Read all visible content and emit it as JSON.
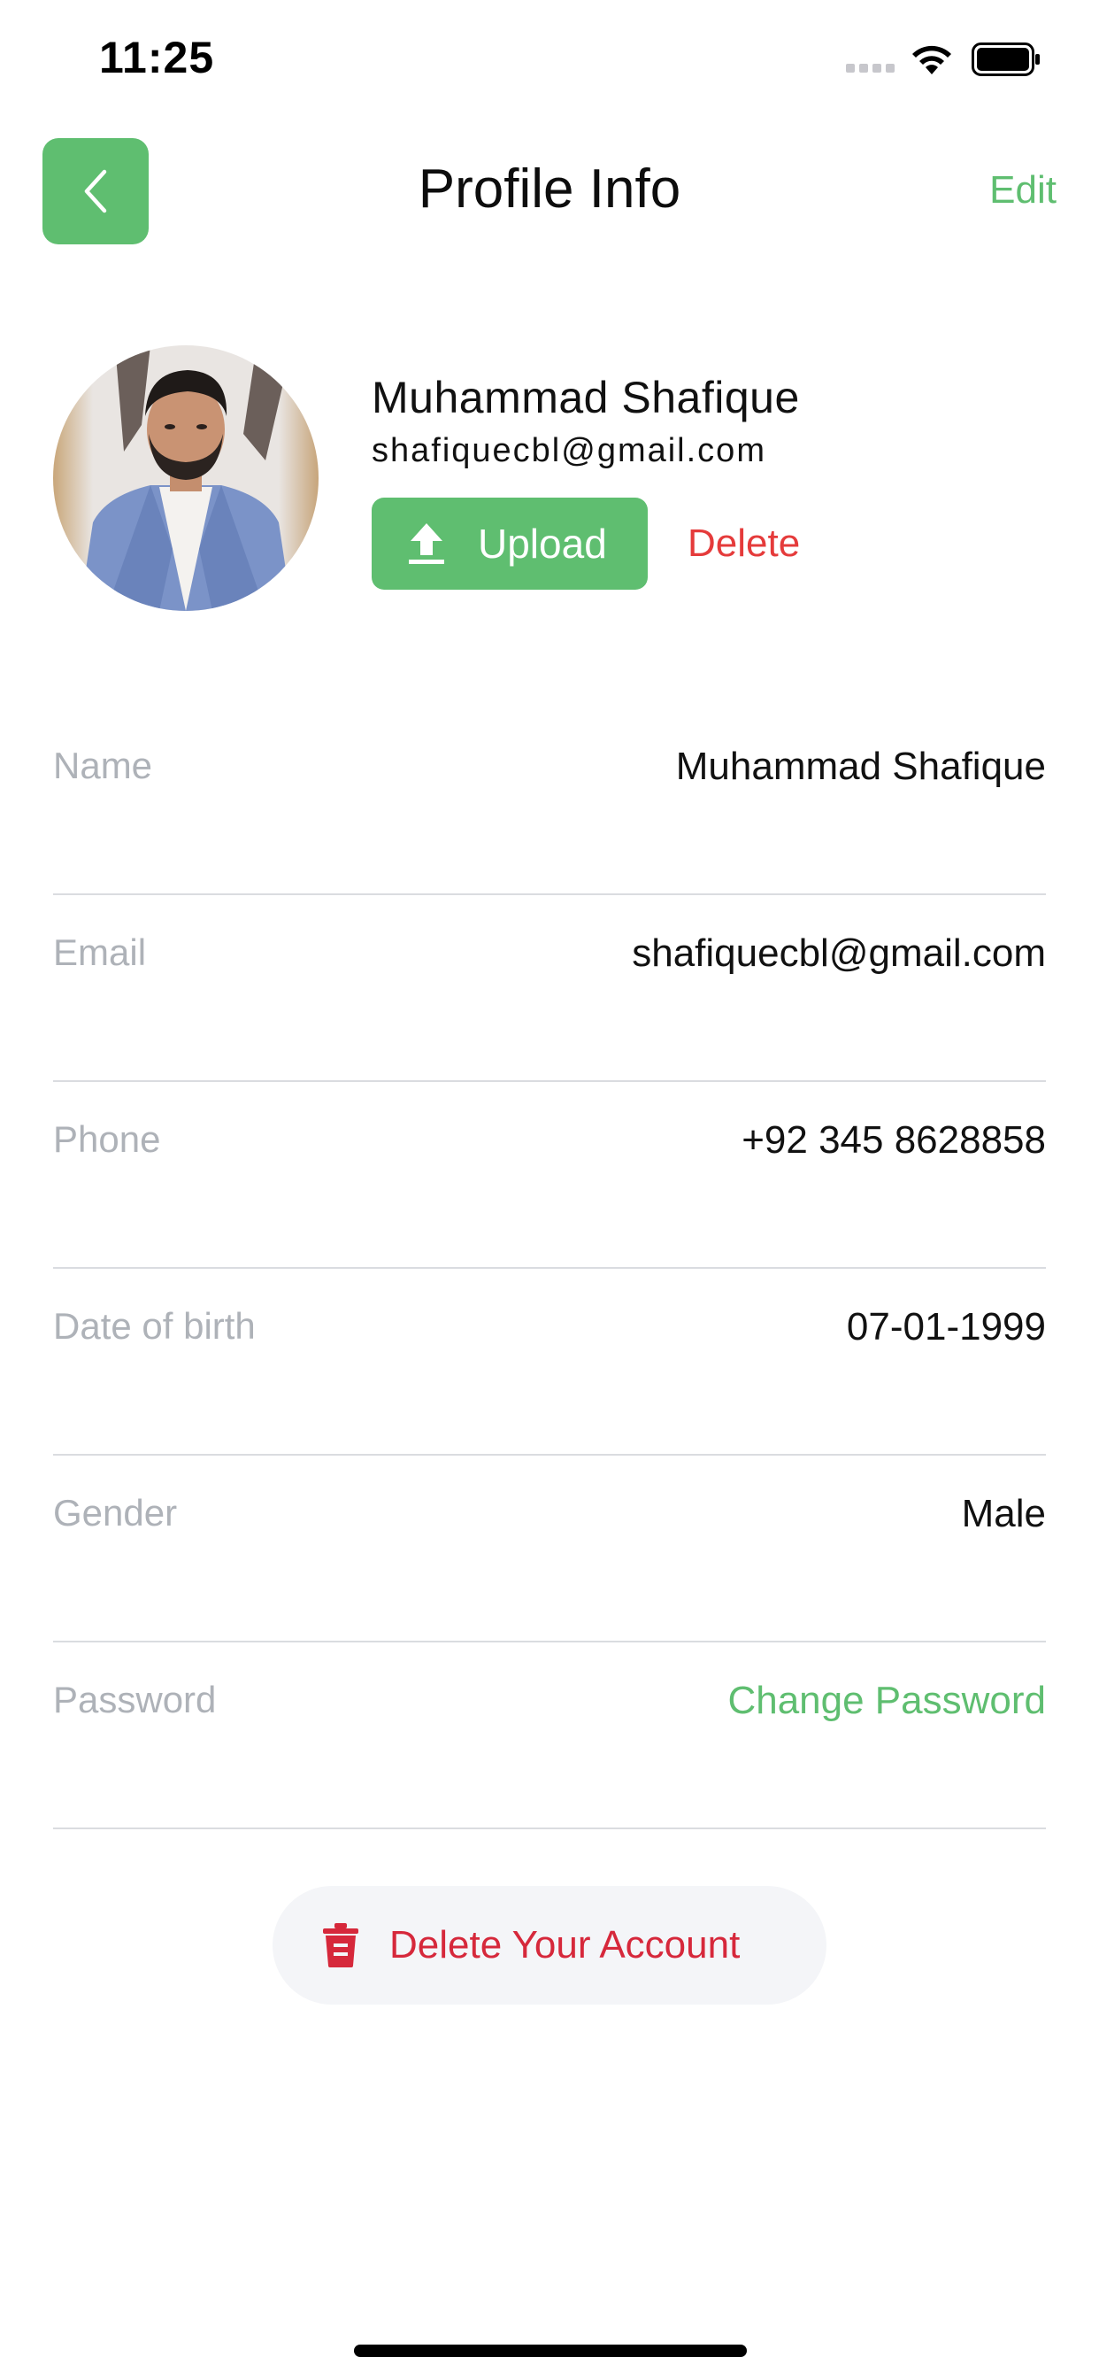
{
  "status_bar": {
    "time": "11:25"
  },
  "header": {
    "title": "Profile Info",
    "edit_label": "Edit",
    "back_icon": "chevron-left-icon"
  },
  "profile": {
    "name": "Muhammad Shafique",
    "email": "shafiquecbl@gmail.com",
    "upload_label": "Upload",
    "delete_label": "Delete"
  },
  "info_rows": [
    {
      "label": "Name",
      "value": "Muhammad Shafique"
    },
    {
      "label": "Email",
      "value": "shafiquecbl@gmail.com"
    },
    {
      "label": "Phone",
      "value": "+92 345 8628858"
    },
    {
      "label": "Date of birth",
      "value": "07-01-1999"
    },
    {
      "label": "Gender",
      "value": "Male"
    },
    {
      "label": "Password",
      "value": "Change Password"
    }
  ],
  "delete_account": {
    "label": "Delete Your Account",
    "icon": "trash-icon"
  },
  "colors": {
    "accent_green": "#5FBE70",
    "danger_red": "#E53B3B",
    "muted_label": "#AEB2B8",
    "divider": "#DADCE0"
  }
}
